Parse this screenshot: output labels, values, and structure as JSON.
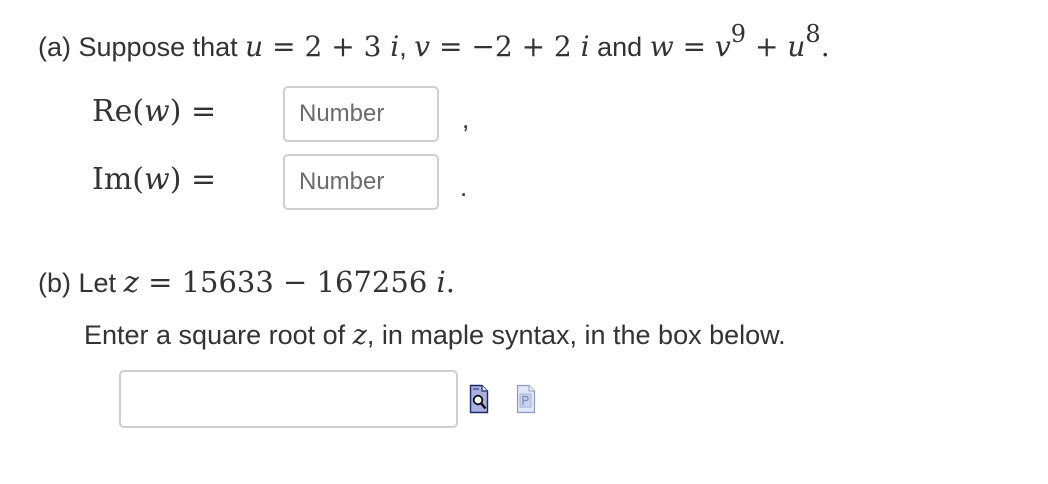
{
  "part_a": {
    "label": "(a)",
    "suppose_text": "Suppose that",
    "u_var": "u",
    "u_value": "= 2 + 3",
    "u_i": "i",
    "comma1": ",",
    "v_var": "v",
    "v_value": "= −2 + 2",
    "v_i": "i",
    "and_text": "and",
    "w_var": "w",
    "w_eq": "=",
    "w_v": "v",
    "w_v_exp": "9",
    "w_plus": "+",
    "w_u": "u",
    "w_u_exp": "8",
    "period": "."
  },
  "re_row": {
    "fn": "Re(",
    "var": "w",
    "close": ") =",
    "placeholder": "Number",
    "punct": ","
  },
  "im_row": {
    "fn": "Im(",
    "var": "w",
    "close": ") =",
    "placeholder": "Number",
    "punct": "."
  },
  "part_b": {
    "label": "(b) Let",
    "z_var": "z",
    "z_value": "= 15633 − 167256",
    "z_i": "i",
    "period": ".",
    "instr_before": "Enter a square root of",
    "instr_var": "z",
    "instr_after": ", in maple syntax, in the box below.",
    "answer_value": ""
  },
  "icons": {
    "preview": "preview-magnifier-icon",
    "help": "maple-syntax-help-icon"
  },
  "colors": {
    "text": "#333333",
    "input_border": "#cfcfcf",
    "placeholder": "#6b6b6b",
    "preview_icon_fill": "#aab0e0",
    "help_icon_fill": "#c9d4ee"
  }
}
